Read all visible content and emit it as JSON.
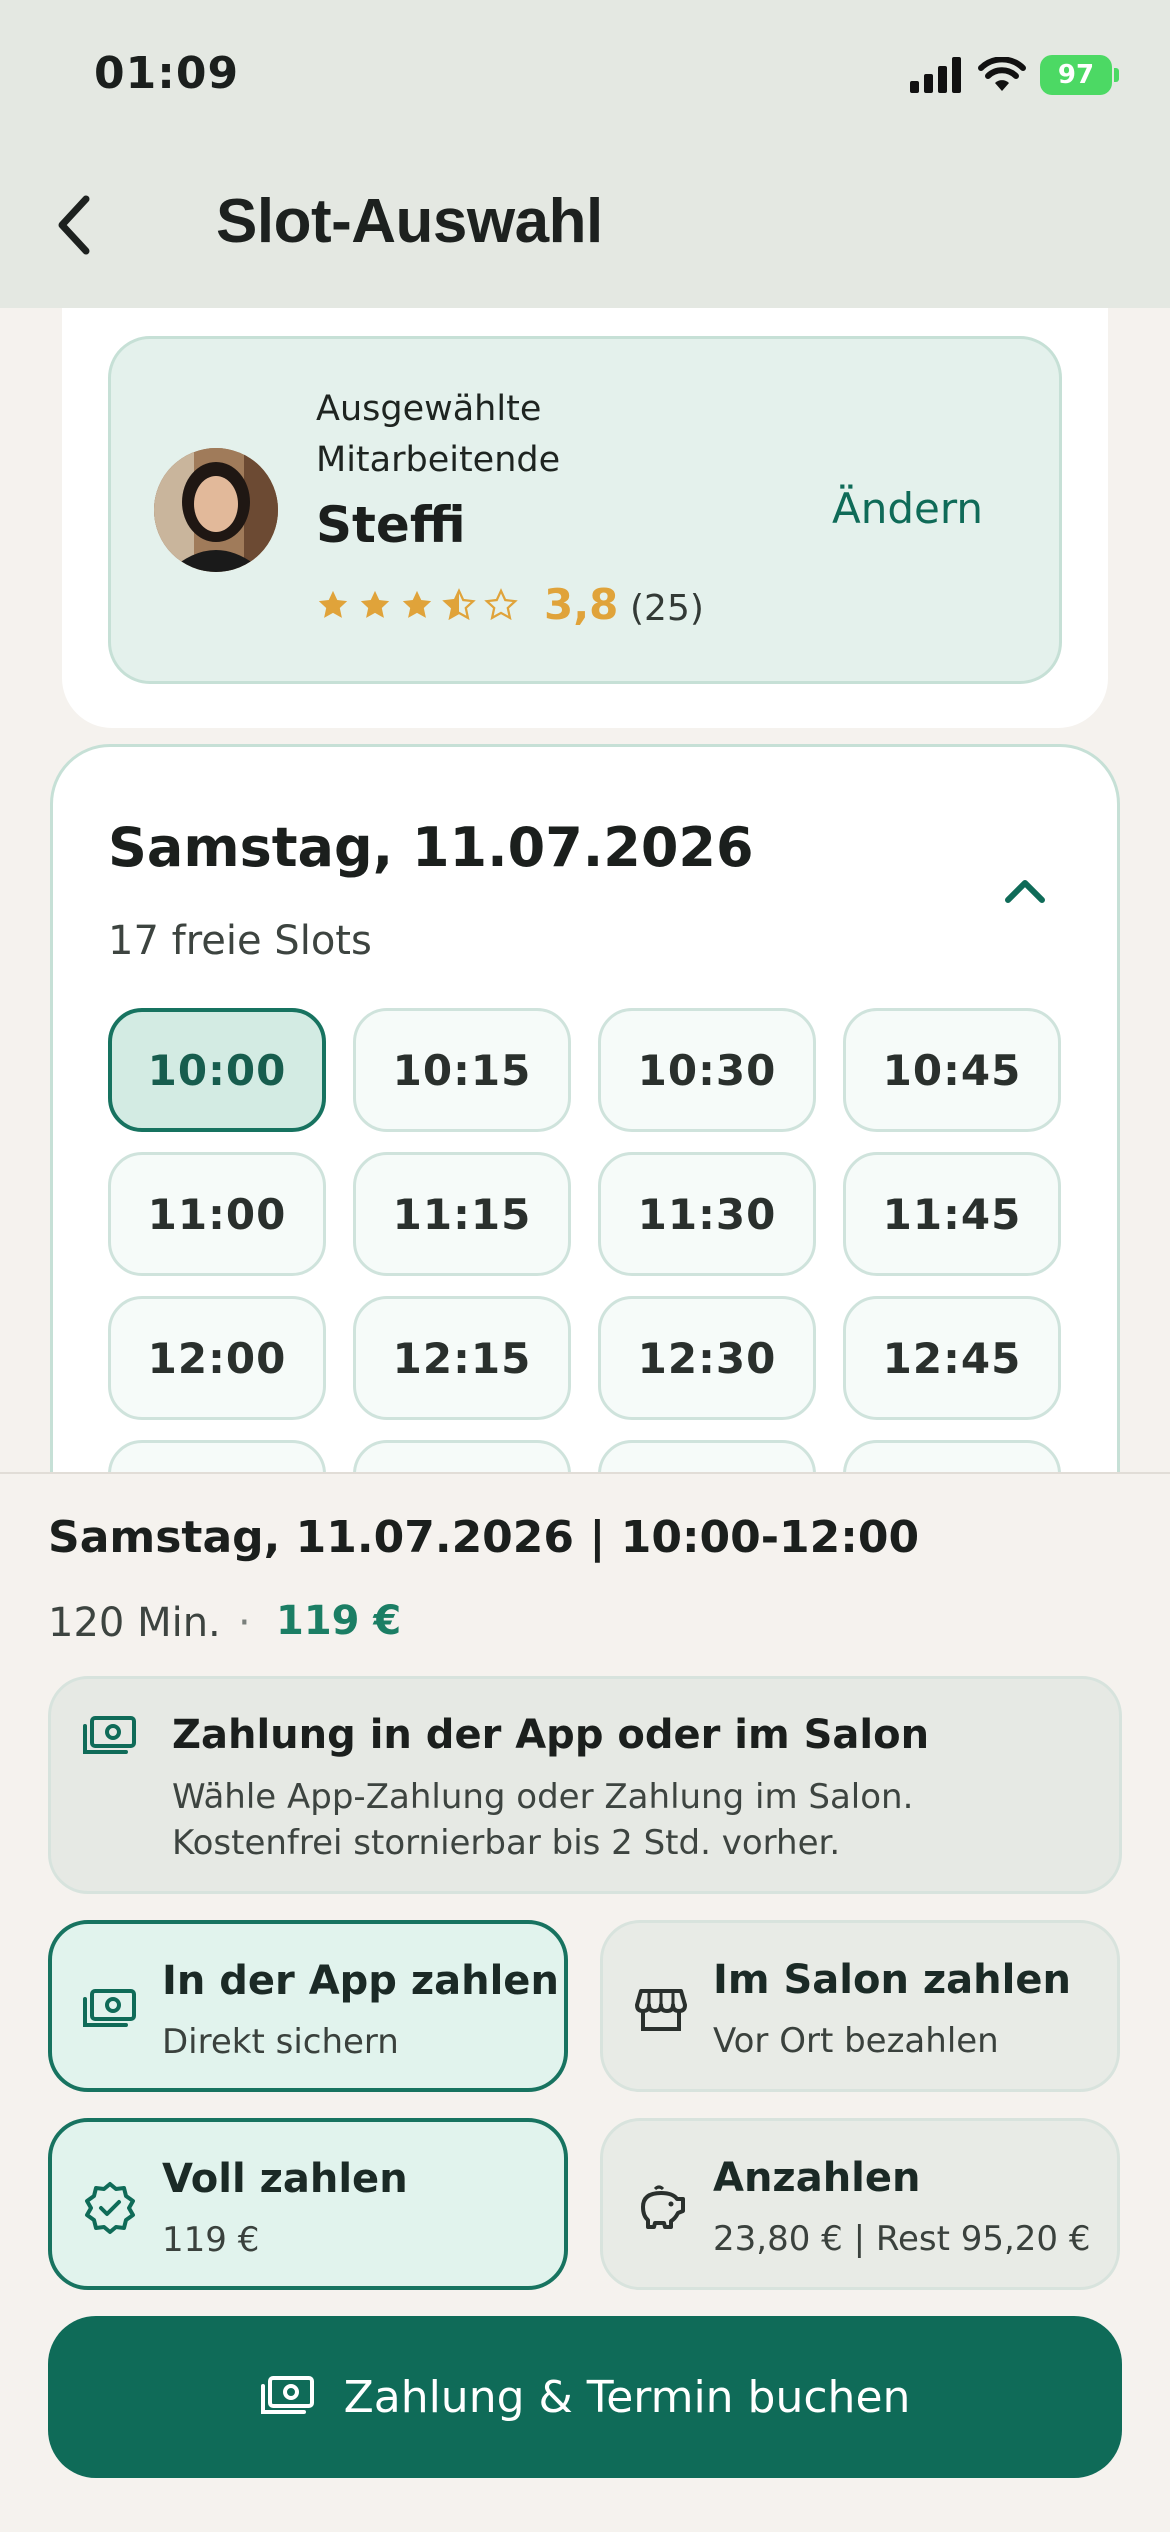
{
  "status_bar": {
    "time": "01:09",
    "battery": "97",
    "icons": [
      "signal-icon",
      "wifi-icon",
      "battery-icon"
    ]
  },
  "header": {
    "title": "Slot-Auswahl",
    "back_icon": "back-arrow-icon"
  },
  "staff": {
    "caption": "Ausgewählte Mitarbeitende",
    "name": "Steffi",
    "rating": "3,8",
    "rating_value": 3.8,
    "reviews": "(25)",
    "change_label": "Ändern"
  },
  "slots": {
    "date": "Samstag, 11.07.2026",
    "free_count": "17 freie Slots",
    "items": [
      "10:00",
      "10:15",
      "10:30",
      "10:45",
      "11:00",
      "11:15",
      "11:30",
      "11:45",
      "12:00",
      "12:15",
      "12:30",
      "12:45"
    ],
    "selected": "10:00"
  },
  "summary": {
    "line": "Samstag, 11.07.2026 | 10:00-12:00",
    "duration": "120 Min.",
    "separator": "·",
    "price": "119 €"
  },
  "payment_info": {
    "title": "Zahlung in der App oder im Salon",
    "text": "Wähle App-Zahlung oder Zahlung im Salon. Kostenfrei stornierbar bis 2 Std. vorher."
  },
  "options": {
    "app": {
      "title": "In der App zahlen",
      "sub": "Direkt sichern",
      "icon": "cash-icon",
      "active": true
    },
    "salon": {
      "title": "Im Salon zahlen",
      "sub": "Vor Ort bezahlen",
      "icon": "store-icon",
      "active": false
    },
    "full": {
      "title": "Voll zahlen",
      "sub": "119 €",
      "icon": "verified-badge-icon",
      "active": true
    },
    "deposit": {
      "title": "Anzahlen",
      "sub": "23,80 € | Rest 95,20 €",
      "icon": "piggy-bank-icon",
      "active": false
    }
  },
  "cta": {
    "label": "Zahlung & Termin buchen",
    "icon": "cash-icon"
  },
  "colors": {
    "brand": "#0f6b58",
    "header_bg": "#e4e8e2",
    "star": "#e0a33a",
    "page_bg": "#f5f2ee"
  }
}
